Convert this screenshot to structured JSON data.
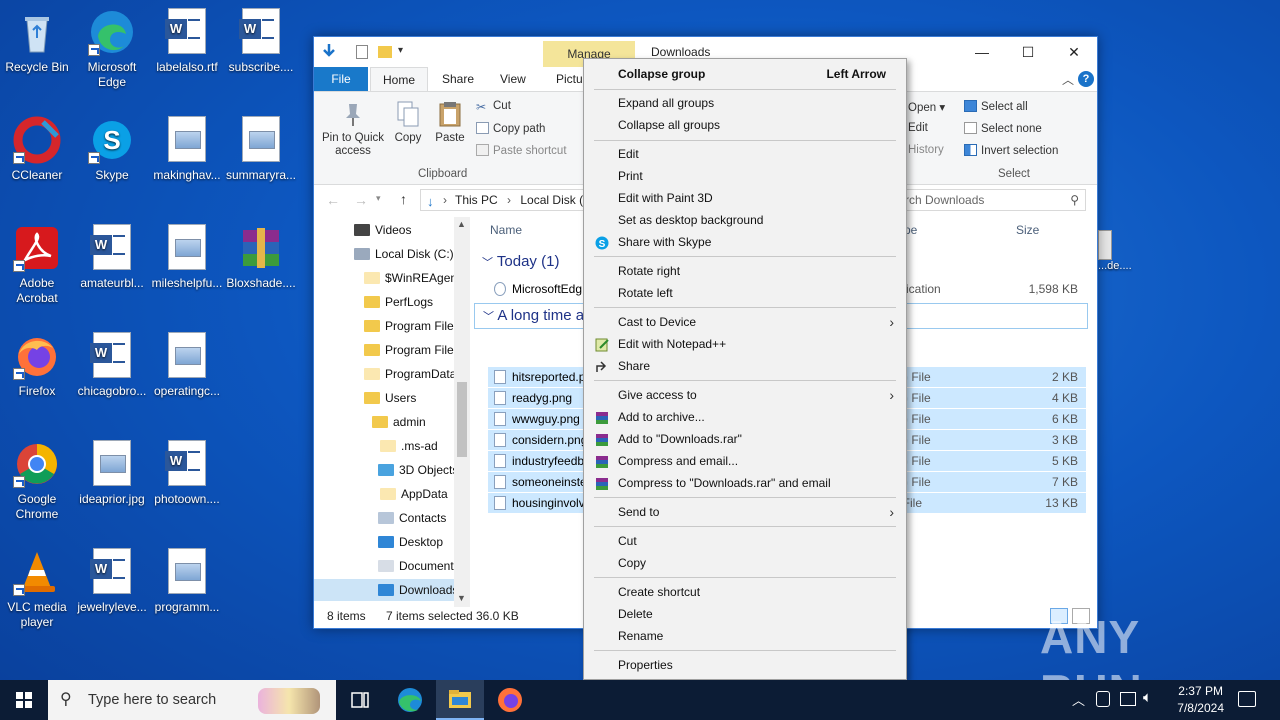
{
  "desktop": {
    "icons": [
      {
        "label": "Recycle Bin"
      },
      {
        "label": "Microsoft Edge"
      },
      {
        "label": "labelalso.rtf"
      },
      {
        "label": "subscribe...."
      },
      {
        "label": "CCleaner"
      },
      {
        "label": "Skype"
      },
      {
        "label": "makinghav..."
      },
      {
        "label": "summaryra..."
      },
      {
        "label": "Adobe Acrobat"
      },
      {
        "label": "amateurbl..."
      },
      {
        "label": "mileshelpfu..."
      },
      {
        "label": "Bloxshade...."
      },
      {
        "label": "Firefox"
      },
      {
        "label": "chicagobro..."
      },
      {
        "label": "operatingc..."
      },
      {
        "label": "Google Chrome"
      },
      {
        "label": "ideaprior.jpg"
      },
      {
        "label": "photoown...."
      },
      {
        "label": "VLC media player"
      },
      {
        "label": "jewelryleve..."
      },
      {
        "label": "programm..."
      }
    ],
    "partial_icon_label": "...de...."
  },
  "explorer": {
    "title": "Downloads",
    "manage_tab": "Manage",
    "tabs": {
      "file": "File",
      "home": "Home",
      "share": "Share",
      "view": "View",
      "picture": "Pictur"
    },
    "ribbon": {
      "pin": "Pin to Quick access",
      "copy": "Copy",
      "paste": "Paste",
      "cut": "Cut",
      "copy_path": "Copy path",
      "paste_shortcut": "Paste shortcut",
      "clipboard": "Clipboard",
      "open": "Open",
      "edit": "Edit",
      "history": "History",
      "select_all": "Select all",
      "select_none": "Select none",
      "invert_selection": "Invert selection",
      "select_group": "Select"
    },
    "address": {
      "this_pc": "This PC",
      "local_disk": "Local Disk (",
      "search_placeholder": "rch Downloads"
    },
    "nav": [
      {
        "label": "Videos"
      },
      {
        "label": "Local Disk (C:)"
      },
      {
        "label": "$WinREAgent"
      },
      {
        "label": "PerfLogs"
      },
      {
        "label": "Program Files"
      },
      {
        "label": "Program Files"
      },
      {
        "label": "ProgramData"
      },
      {
        "label": "Users"
      },
      {
        "label": "admin"
      },
      {
        "label": ".ms-ad"
      },
      {
        "label": "3D Objects"
      },
      {
        "label": "AppData"
      },
      {
        "label": "Contacts"
      },
      {
        "label": "Desktop"
      },
      {
        "label": "Documents"
      },
      {
        "label": "Downloads"
      }
    ],
    "columns": {
      "name": "Name",
      "type": "pe",
      "size": "Size"
    },
    "groups": {
      "today": "Today (1)",
      "longtime": "A long time a"
    },
    "today_files": [
      {
        "name": "MicrosoftEdg",
        "type": "pplication",
        "size": "1,598 KB"
      }
    ],
    "old_files": [
      {
        "name": "hitsreported.p",
        "type": "NG File",
        "size": "2 KB"
      },
      {
        "name": "readyg.png",
        "type": "NG File",
        "size": "4 KB"
      },
      {
        "name": "wwwguy.png",
        "type": "NG File",
        "size": "6 KB"
      },
      {
        "name": "considern.png",
        "type": "NG File",
        "size": "3 KB"
      },
      {
        "name": "industryfeedb",
        "type": "NG File",
        "size": "5 KB"
      },
      {
        "name": "someoneinste",
        "type": "NG File",
        "size": "7 KB"
      },
      {
        "name": "housinginvolv",
        "type": "G File",
        "size": "13 KB"
      }
    ],
    "status": {
      "items": "8 items",
      "selected": "7 items selected",
      "size": "36.0 KB"
    }
  },
  "context_menu": {
    "collapse_group": "Collapse group",
    "collapse_group_accel": "Left Arrow",
    "expand_all": "Expand all groups",
    "collapse_all": "Collapse all groups",
    "edit": "Edit",
    "print": "Print",
    "edit_paint3d": "Edit with Paint 3D",
    "set_bg": "Set as desktop background",
    "share_skype": "Share with Skype",
    "rotate_right": "Rotate right",
    "rotate_left": "Rotate left",
    "cast": "Cast to Device",
    "edit_npp": "Edit with Notepad++",
    "share": "Share",
    "give_access": "Give access to",
    "add_archive": "Add to archive...",
    "add_rar": "Add to \"Downloads.rar\"",
    "compress_email": "Compress and email...",
    "compress_rar_email": "Compress to \"Downloads.rar\" and email",
    "send_to": "Send to",
    "cut": "Cut",
    "copy": "Copy",
    "create_shortcut": "Create shortcut",
    "delete": "Delete",
    "rename": "Rename",
    "properties": "Properties"
  },
  "taskbar": {
    "search_placeholder": "Type here to search",
    "time": "2:37 PM",
    "date": "7/8/2024"
  },
  "watermark": "ANY RUN"
}
